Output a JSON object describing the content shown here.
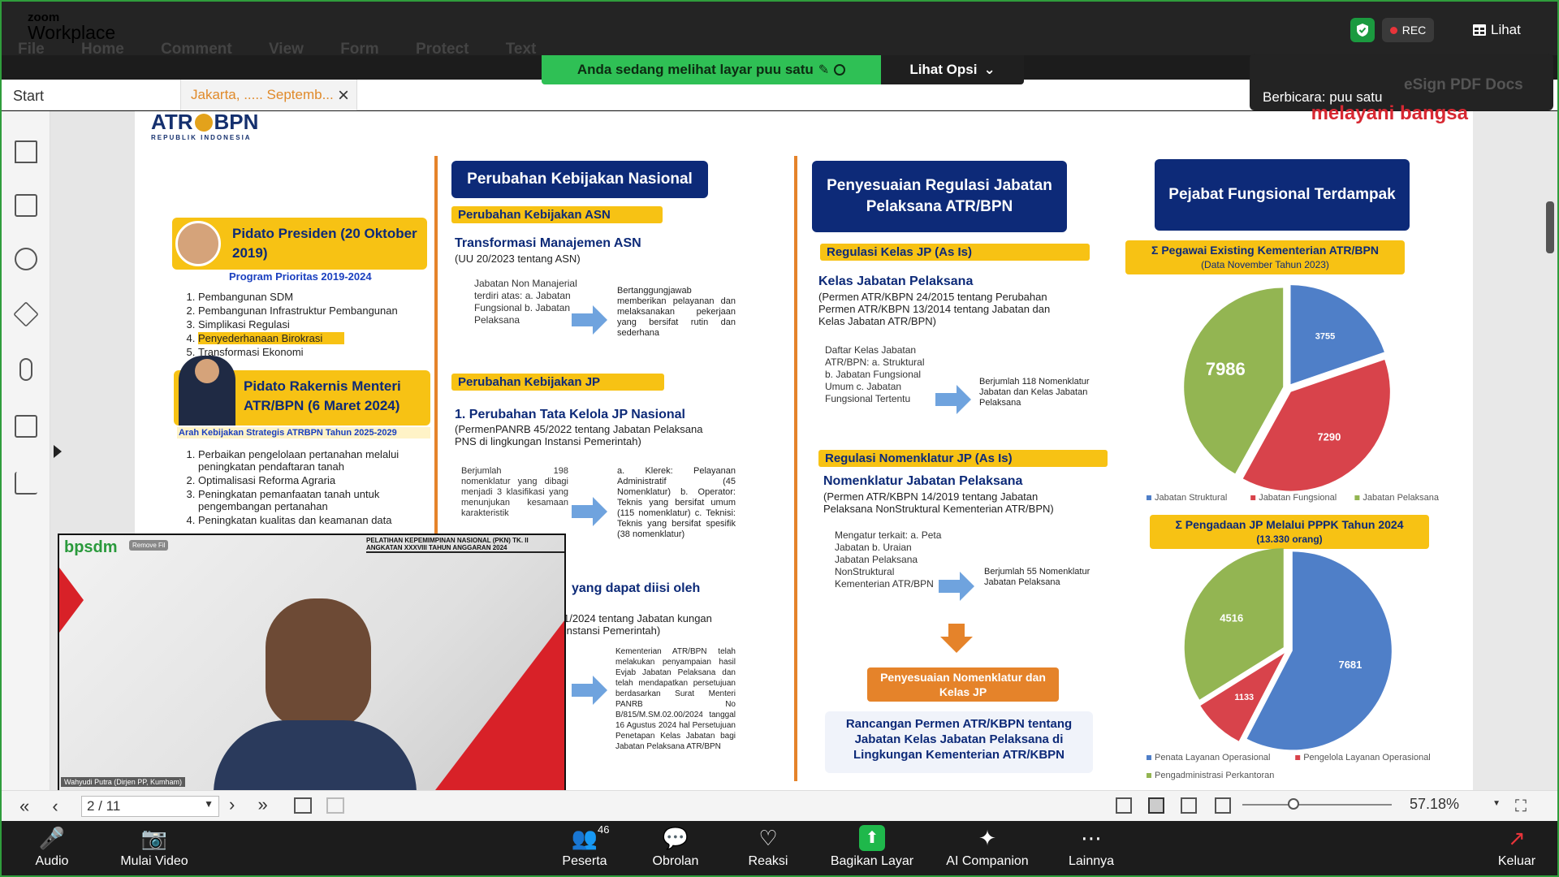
{
  "zoom": {
    "brand_top": "zoom",
    "brand_bottom": "Workplace",
    "ghost_menu": "File   Home   Comment   View   Form   Protect   Text",
    "rec_label": "REC",
    "view_label": "Lihat",
    "share_banner": "Anda sedang melihat layar  puu satu",
    "view_options": "Lihat Opsi",
    "speaker_label": "Berbicara: puu satu",
    "participants_count": "46",
    "toolbar": [
      {
        "id": "audio",
        "label": "Audio"
      },
      {
        "id": "video",
        "label": "Mulai Video"
      },
      {
        "id": "participants",
        "label": "Peserta"
      },
      {
        "id": "chat",
        "label": "Obrolan"
      },
      {
        "id": "reactions",
        "label": "Reaksi"
      },
      {
        "id": "share",
        "label": "Bagikan Layar"
      },
      {
        "id": "ai",
        "label": "AI Companion"
      },
      {
        "id": "more",
        "label": "Lainnya"
      },
      {
        "id": "leave",
        "label": "Keluar"
      }
    ]
  },
  "pdf": {
    "tab_start": "Start",
    "tab_doc": "Jakarta, ..... Septemb...",
    "page_indicator": "2 / 11",
    "zoom_level": "57.18%",
    "esign": "eSign PDF Docs"
  },
  "slide": {
    "logo": "ATR BPN",
    "logo_sub": "REPUBLIK INDONESIA",
    "logo_right": "melayani bangsa",
    "col1": {
      "box1_title": "Pidato Presiden (20 Oktober 2019)",
      "box1_sub": "Program Prioritas 2019-2024",
      "box1_items": [
        "Pembangunan SDM",
        "Pembangunan Infrastruktur Pembangunan",
        "Simplikasi Regulasi",
        "Penyederhanaan Birokrasi",
        "Transformasi Ekonomi"
      ],
      "box2_title": "Pidato Rakernis Menteri ATR/BPN (6 Maret 2024)",
      "box2_sub": "Arah Kebijakan Strategis ATRBPN Tahun 2025-2029",
      "box2_items": [
        "Perbaikan pengelolaan pertanahan melalui peningkatan pendaftaran tanah",
        "Optimalisasi Reforma Agraria",
        "Peningkatan pemanfaatan tanah untuk pengembangan pertanahan",
        "Peningkatan kualitas dan keamanan data"
      ]
    },
    "col2": {
      "title": "Perubahan Kebijakan Nasional",
      "asn_label": "Perubahan Kebijakan ASN",
      "asn_head": "Transformasi Manajemen ASN",
      "asn_law": "(UU 20/2023 tentang ASN)",
      "asn_left": "Jabatan Non Manajerial terdiri atas: a. Jabatan Fungsional b. Jabatan Pelaksana",
      "asn_right": "Bertanggungjawab memberikan pelayanan dan melaksanakan pekerjaan yang bersifat rutin dan sederhana",
      "jp_label": "Perubahan Kebijakan JP",
      "jp_head": "1. Perubahan Tata Kelola JP Nasional",
      "jp_law": "(PermenPANRB 45/2022 tentang Jabatan Pelaksana PNS di lingkungan Instansi Pemerintah)",
      "jp_left": "Berjumlah 198 nomenklatur yang dibagi menjadi 3 klasifikasi yang menunjukan kesamaan karakteristik",
      "jp_right": "a. Klerek: Pelayanan Administratif (45 Nomenklatur) b. Operator: Teknis yang bersifat umum (115 nomenklatur) c. Teknisi: Teknis yang bersifat spesifik (38 nomenklatur)",
      "jp2_head": "yang dapat diisi oleh",
      "jp2_law": "1/2024 tentang Jabatan kungan Instansi Pemerintah)",
      "jp2_right": "Kementerian ATR/BPN telah melakukan penyampaian hasil Evjab Jabatan Pelaksana dan telah mendapatkan persetujuan berdasarkan Surat Menteri PANRB No B/815/M.SM.02.00/2024 tanggal 16 Agustus 2024 hal Persetujuan Penetapan Kelas Jabatan bagi Jabatan Pelaksana ATR/BPN"
    },
    "col3": {
      "title": "Penyesuaian Regulasi Jabatan Pelaksana ATR/BPN",
      "kelas_label": "Regulasi Kelas JP (As Is)",
      "kelas_head": "Kelas Jabatan Pelaksana",
      "kelas_law": "(Permen ATR/KBPN 24/2015 tentang Perubahan Permen ATR/KBPN 13/2014 tentang Jabatan dan Kelas Jabatan ATR/BPN)",
      "kelas_left": "Daftar Kelas Jabatan ATR/BPN: a. Struktural b. Jabatan Fungsional Umum c. Jabatan Fungsional Tertentu",
      "kelas_right": "Berjumlah 118 Nomenklatur Jabatan dan Kelas Jabatan Pelaksana",
      "nomen_label": "Regulasi Nomenklatur JP (As Is)",
      "nomen_head": "Nomenklatur Jabatan Pelaksana",
      "nomen_law": "(Permen ATR/KBPN 14/2019 tentang Jabatan Pelaksana NonStruktural Kementerian ATR/BPN)",
      "nomen_left": "Mengatur terkait: a. Peta Jabatan b. Uraian Jabatan Pelaksana NonStruktural Kementerian ATR/BPN",
      "nomen_right": "Berjumlah 55 Nomenklatur Jabatan Pelaksana",
      "adjust": "Penyesuaian Nomenklatur dan Kelas JP",
      "draft": "Rancangan Permen ATR/KBPN tentang Jabatan Kelas Jabatan Pelaksana di Lingkungan Kementerian ATR/KBPN"
    },
    "col4": {
      "title": "Pejabat Fungsional Terdampak"
    },
    "video": {
      "org": "bpsdm",
      "banner": "PELATIHAN KEPEMIMPINAN NASIONAL (PKN) TK. II ANGKATAN XXXVIII TAHUN ANGGARAN 2024",
      "name": "Wahyudi Putra (Dirjen PP, Kumham)",
      "remove": "Remove Fil"
    }
  },
  "chart_data": [
    {
      "type": "pie",
      "title": "Σ Pegawai Existing Kementerian ATR/BPN",
      "subtitle": "(Data November Tahun 2023)",
      "categories": [
        "Jabatan Struktural",
        "Jabatan Fungsional",
        "Jabatan Pelaksana"
      ],
      "values": [
        3755,
        7290,
        7986
      ],
      "colors": [
        "#4f7fc8",
        "#d8434b",
        "#93b552"
      ],
      "legend": "bottom"
    },
    {
      "type": "pie",
      "title": "Σ Pengadaan JP Melalui PPPK Tahun 2024",
      "subtitle": "(13.330 orang)",
      "categories": [
        "Penata Layanan Operasional",
        "Pengelola Layanan Operasional",
        "Pengadministrasi Perkantoran"
      ],
      "values": [
        7681,
        1133,
        4516
      ],
      "colors": [
        "#4f7fc8",
        "#d8434b",
        "#93b552"
      ],
      "legend": "bottom"
    }
  ]
}
